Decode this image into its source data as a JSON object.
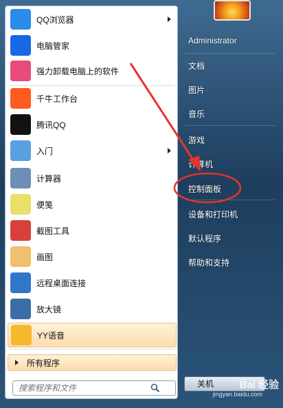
{
  "left_items": [
    {
      "label": "QQ浏览器",
      "has_arrow": true,
      "icon": "qq-browser-icon",
      "color": "#2a8ce8"
    },
    {
      "label": "电脑管家",
      "has_arrow": false,
      "icon": "pc-manager-shield-icon",
      "color": "#1668e6"
    },
    {
      "label": "强力卸载电脑上的软件",
      "has_arrow": false,
      "icon": "uninstall-flower-icon",
      "color": "#e84a7a"
    },
    {
      "label": "千牛工作台",
      "has_arrow": false,
      "icon": "qianniu-icon",
      "color": "#ff5a1f"
    },
    {
      "label": "腾讯QQ",
      "has_arrow": false,
      "icon": "qq-penguin-icon",
      "color": "#111111"
    },
    {
      "label": "入门",
      "has_arrow": true,
      "icon": "getting-started-icon",
      "color": "#5aa0e0"
    },
    {
      "label": "计算器",
      "has_arrow": false,
      "icon": "calculator-icon",
      "color": "#6d8fb5"
    },
    {
      "label": "便笺",
      "has_arrow": false,
      "icon": "sticky-notes-icon",
      "color": "#e8e06a"
    },
    {
      "label": "截图工具",
      "has_arrow": false,
      "icon": "snipping-tool-icon",
      "color": "#d9403a"
    },
    {
      "label": "画图",
      "has_arrow": false,
      "icon": "paint-palette-icon",
      "color": "#f0c070"
    },
    {
      "label": "远程桌面连接",
      "has_arrow": false,
      "icon": "remote-desktop-icon",
      "color": "#2f78c8"
    },
    {
      "label": "放大镜",
      "has_arrow": false,
      "icon": "magnifier-icon",
      "color": "#3a6ea8"
    },
    {
      "label": "YY语音",
      "has_arrow": false,
      "icon": "yy-voice-icon",
      "color": "#f5b82e"
    }
  ],
  "all_programs_label": "所有程序",
  "search_placeholder": "搜索程序和文件",
  "right_items": [
    "Administrator",
    "文档",
    "图片",
    "音乐",
    "游戏",
    "计算机",
    "控制面板",
    "设备和打印机",
    "默认程序",
    "帮助和支持"
  ],
  "shutdown_label": "关机",
  "watermark": "Bai 经验",
  "watermark_url": "jingyan.baidu.com",
  "annotation_color": "#e8322d"
}
